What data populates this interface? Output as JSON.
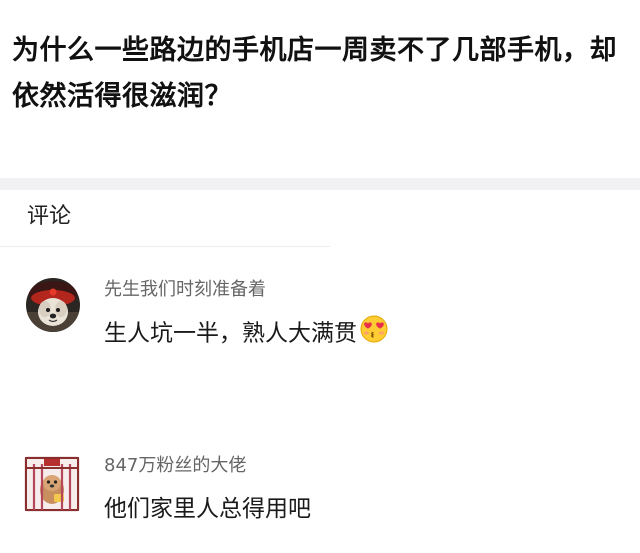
{
  "question": {
    "title": "为什么一些路边的手机店一周卖不了几部手机，却依然活得很滋润？"
  },
  "comments_section": {
    "label": "评论"
  },
  "comments": [
    {
      "username": "先生我们时刻准备着",
      "text": "生人坑一半，熟人大满贯",
      "emoji": "heart-eyes-face-icon",
      "avatar": "dog-in-red-hat-avatar"
    },
    {
      "username": "847万粉丝的大佬",
      "text": "他们家里人总得用吧",
      "avatar": "dog-in-cage-avatar"
    }
  ],
  "colors": {
    "background": "#ffffff",
    "divider": "#f1f1f3",
    "username": "#666666",
    "text": "#1a1a1a"
  }
}
